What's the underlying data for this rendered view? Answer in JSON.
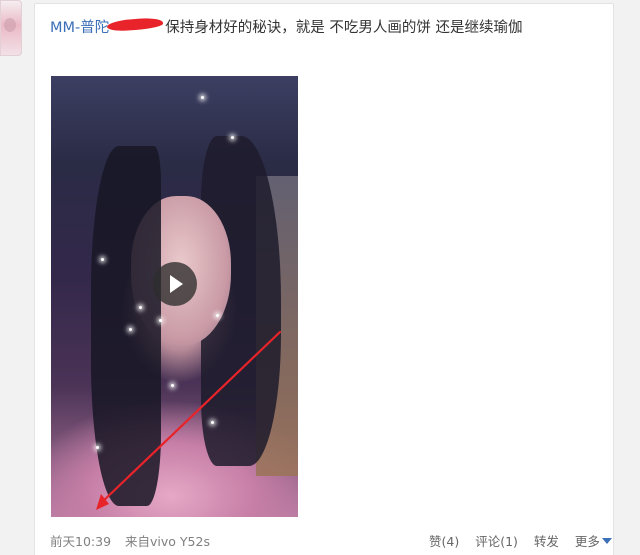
{
  "post": {
    "author": "MM-普陀",
    "text": "保持身材好的秘诀，就是 不吃男人画的饼 还是继续瑜伽"
  },
  "media": {
    "type": "video",
    "play_icon": "play-icon"
  },
  "meta": {
    "time": "前天10:39",
    "device": "来自vivo Y52s"
  },
  "actions": {
    "like": "赞(4)",
    "comment": "评论(1)",
    "repost": "转发",
    "more": "更多"
  },
  "colors": {
    "link": "#3b6fb7",
    "annotation_arrow": "#e8232a",
    "redaction": "#e8232a"
  }
}
